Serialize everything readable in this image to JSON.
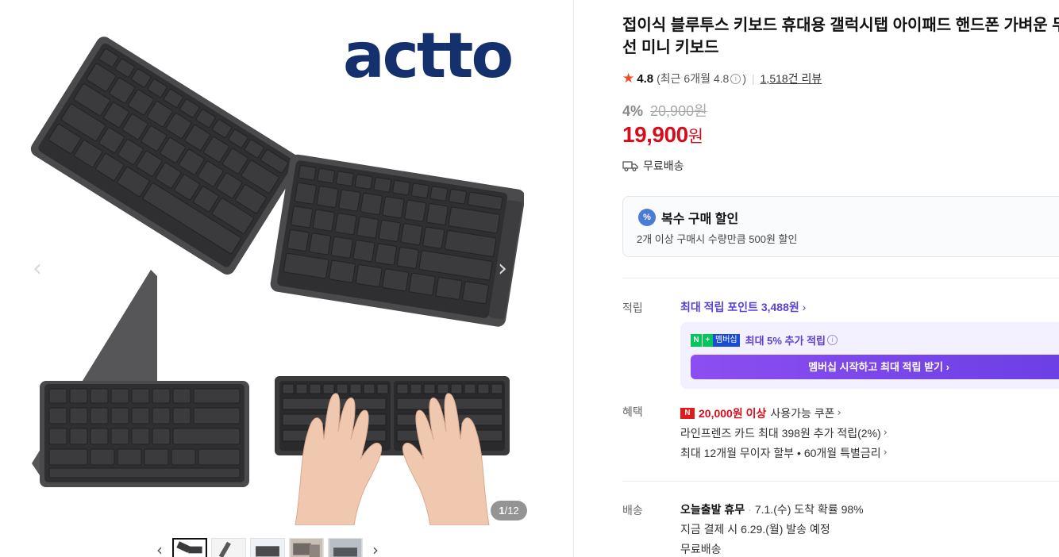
{
  "gallery": {
    "brand_logo": "actto",
    "counter_current": "1",
    "counter_total": "/12",
    "prev_arrow": "‹",
    "next_arrow": "›",
    "thumb_prev": "‹",
    "thumb_next": "›"
  },
  "product": {
    "title": "접이식 블루투스 키보드 휴대용 갤럭시탭 아이패드 핸드폰 가벼운 무선 미니 키보드",
    "rating": "4.8",
    "rating_recent": "(최근 6개월 4.8",
    "rating_recent_close": ")",
    "review_count": "1,518건 리뷰",
    "discount_rate": "4%",
    "original_price": "20,900원",
    "price": "19,900",
    "price_unit": "원",
    "shipping": "무료배송"
  },
  "multi_discount": {
    "badge": "%",
    "title": "복수 구매 할인",
    "description": "2개 이상 구매시 수량만큼 500원 할인"
  },
  "points": {
    "label": "적립",
    "max_text": "최대 적립 포인트",
    "max_value": "3,488원",
    "member_text": "최대 5% 추가 적립",
    "member_badge_mem": "멤버십",
    "cta": "멤버십 시작하고 최대 적립 받기 ›"
  },
  "benefits": {
    "label": "혜택",
    "coupon_strong": "20,000원 이상",
    "coupon_text": "사용가능 쿠폰",
    "card_text": "라인프렌즈 카드 최대 398원 추가 적립(2%)",
    "installment_text": "최대 12개월 무이자 할부 • 60개월 특별금리"
  },
  "delivery": {
    "label": "배송",
    "today_title": "오늘출발 휴무",
    "arrival": "7.1.(수) 도착 확률 98%",
    "ship_date": "지금 결제 시 6.29.(월) 발송 예정",
    "fee": "무료배송"
  },
  "colors": {
    "price_red": "#d60d1c",
    "point_purple": "#5c3fd3",
    "brand_navy": "#14306d",
    "star": "#f04b25"
  }
}
